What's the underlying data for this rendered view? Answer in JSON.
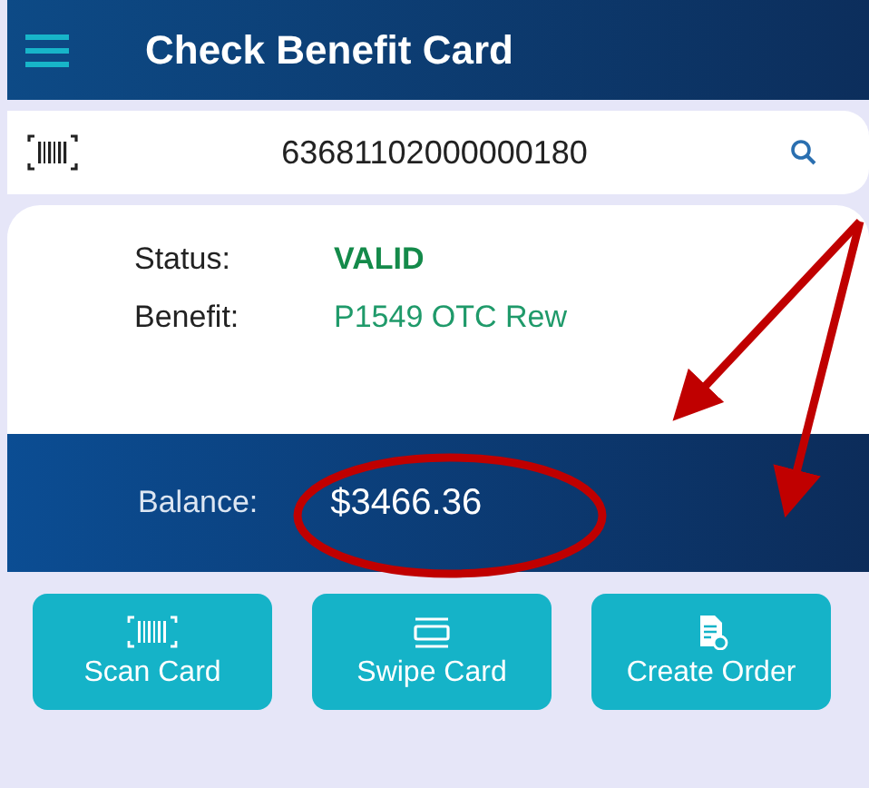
{
  "header": {
    "title": "Check Benefit Card"
  },
  "search": {
    "value": "63681102000000180"
  },
  "details": [
    {
      "label": "Status:",
      "value": "VALID",
      "kind": "status"
    },
    {
      "label": "Benefit:",
      "value": "P1549 OTC Rew",
      "kind": "plain"
    }
  ],
  "balance": {
    "label": "Balance:",
    "value": "$3466.36"
  },
  "buttons": [
    {
      "label": "Scan Card",
      "kind": "scan"
    },
    {
      "label": "Swipe Card",
      "kind": "swipe"
    },
    {
      "label": "Create Order",
      "kind": "order"
    }
  ]
}
